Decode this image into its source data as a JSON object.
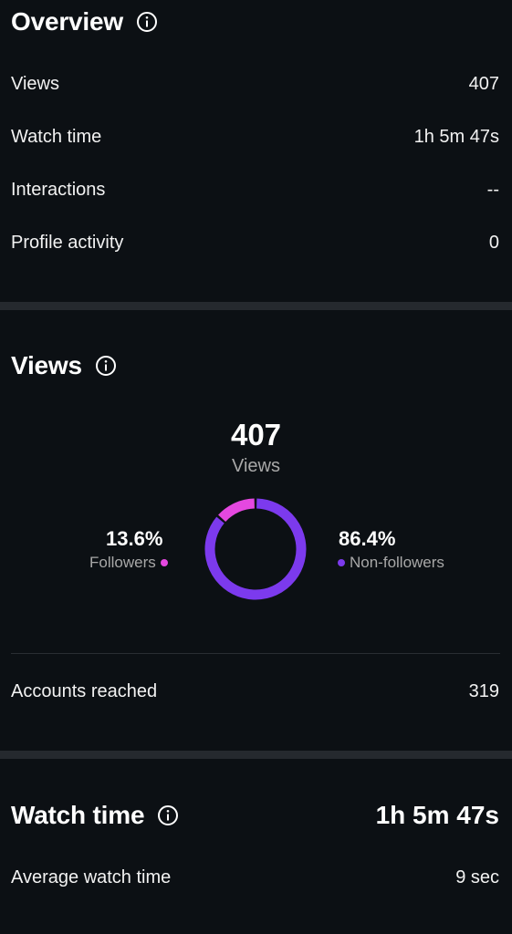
{
  "overview": {
    "title": "Overview",
    "rows": [
      {
        "label": "Views",
        "value": "407"
      },
      {
        "label": "Watch time",
        "value": "1h 5m 47s"
      },
      {
        "label": "Interactions",
        "value": "--"
      },
      {
        "label": "Profile activity",
        "value": "0"
      }
    ]
  },
  "views": {
    "title": "Views",
    "total": "407",
    "total_label": "Views",
    "followers_pct": "13.6%",
    "followers_label": "Followers",
    "followers_fraction": 0.136,
    "nonfollowers_pct": "86.4%",
    "nonfollowers_label": "Non-followers",
    "nonfollowers_fraction": 0.864,
    "accounts_reached_label": "Accounts reached",
    "accounts_reached_value": "319"
  },
  "watch_time": {
    "title": "Watch time",
    "total": "1h 5m 47s",
    "average_label": "Average watch time",
    "average_value": "9 sec"
  },
  "colors": {
    "background": "#0c1014",
    "followers": "#e548e0",
    "nonfollowers": "#7c3aed",
    "divider": "#25292e",
    "muted_text": "#a8a8a8"
  }
}
